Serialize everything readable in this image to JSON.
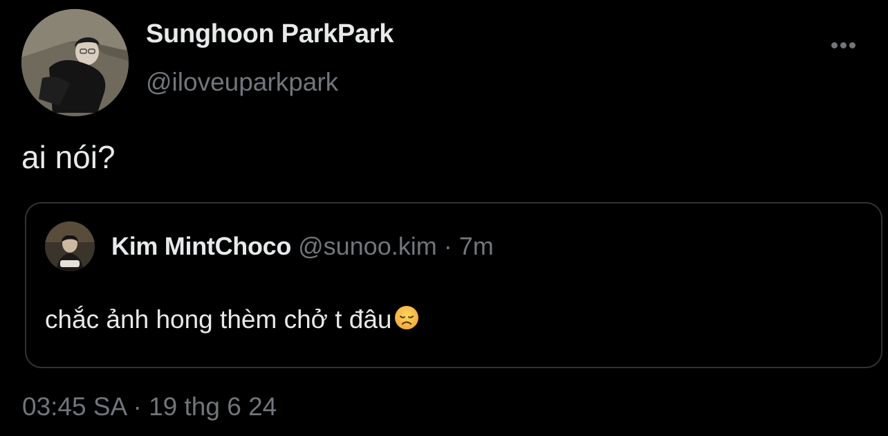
{
  "tweet": {
    "author": {
      "display_name": "Sunghoon ParkPark",
      "handle": "@iloveuparkpark"
    },
    "text": "ai nói?",
    "more_icon": "ellipsis-icon",
    "quoted": {
      "display_name": "Kim MintChoco",
      "handle": "@sunoo.kim",
      "separator": "·",
      "time": "7m",
      "text": "chắc ảnh hong thèm chở t đâu",
      "emoji": "disappointed-face-emoji"
    },
    "timestamp": "03:45 SA · 19 thg 6 24"
  },
  "colors": {
    "background": "#000000",
    "primary_text": "#e7e9ea",
    "secondary_text": "#71767b",
    "border": "#2f3336"
  }
}
